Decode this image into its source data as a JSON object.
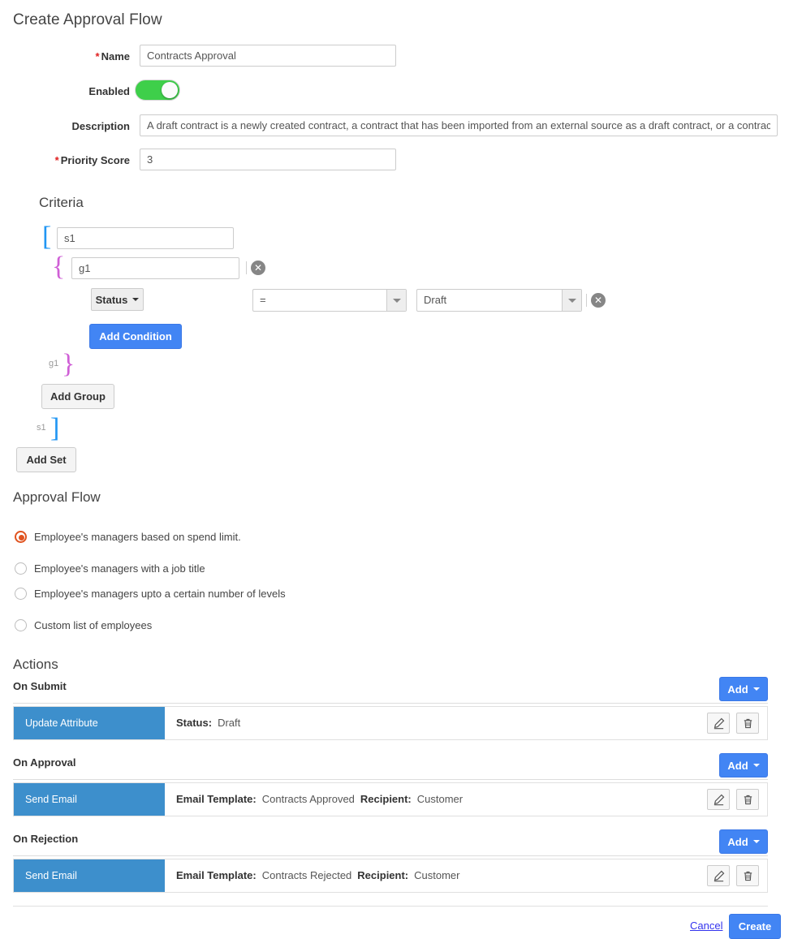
{
  "page": {
    "title": "Create Approval Flow"
  },
  "form": {
    "name": {
      "label": "Name",
      "required_marker": "*",
      "value": "Contracts Approval"
    },
    "enabled": {
      "label": "Enabled",
      "state": "on"
    },
    "description": {
      "label": "Description",
      "value": "A draft contract is a newly created contract, a contract that has been imported from an external source as a draft contract, or a contract that has"
    },
    "priority_score": {
      "label": "Priority Score",
      "required_marker": "*",
      "value": "3"
    }
  },
  "criteria": {
    "heading": "Criteria",
    "set_open_bracket": "[",
    "set_close_bracket": "]",
    "set_name": "s1",
    "set_close_tag": "s1",
    "group_open_brace": "{",
    "group_close_brace": "}",
    "group_name": "g1",
    "group_close_tag": "g1",
    "remove_group_icon": "close-circle-icon",
    "remove_condition_icon": "close-circle-icon",
    "condition": {
      "field": "Status",
      "operator": "=",
      "value": "Draft"
    },
    "add_condition_label": "Add Condition",
    "add_group_label": "Add Group",
    "add_set_label": "Add Set"
  },
  "approval_flow": {
    "heading": "Approval Flow",
    "selected_index": 0,
    "accent_color": "#e0531f",
    "options": [
      "Employee's managers based on spend limit.",
      "Employee's managers with a job title",
      "Employee's managers upto a certain number of levels",
      "Custom list of employees"
    ]
  },
  "actions": {
    "heading": "Actions",
    "add_label": "Add",
    "edit_icon": "pencil-icon",
    "delete_icon": "trash-icon",
    "groups": [
      {
        "title": "On Submit",
        "row": {
          "type": "Update Attribute",
          "fields": [
            {
              "label": "Status:",
              "value": "Draft"
            }
          ]
        }
      },
      {
        "title": "On Approval",
        "row": {
          "type": "Send Email",
          "fields": [
            {
              "label": "Email Template:",
              "value": "Contracts Approved"
            },
            {
              "label": "Recipient:",
              "value": "Customer"
            }
          ]
        }
      },
      {
        "title": "On Rejection",
        "row": {
          "type": "Send Email",
          "fields": [
            {
              "label": "Email Template:",
              "value": "Contracts Rejected"
            },
            {
              "label": "Recipient:",
              "value": "Customer"
            }
          ]
        }
      }
    ]
  },
  "footer": {
    "cancel_label": "Cancel",
    "create_label": "Create"
  }
}
